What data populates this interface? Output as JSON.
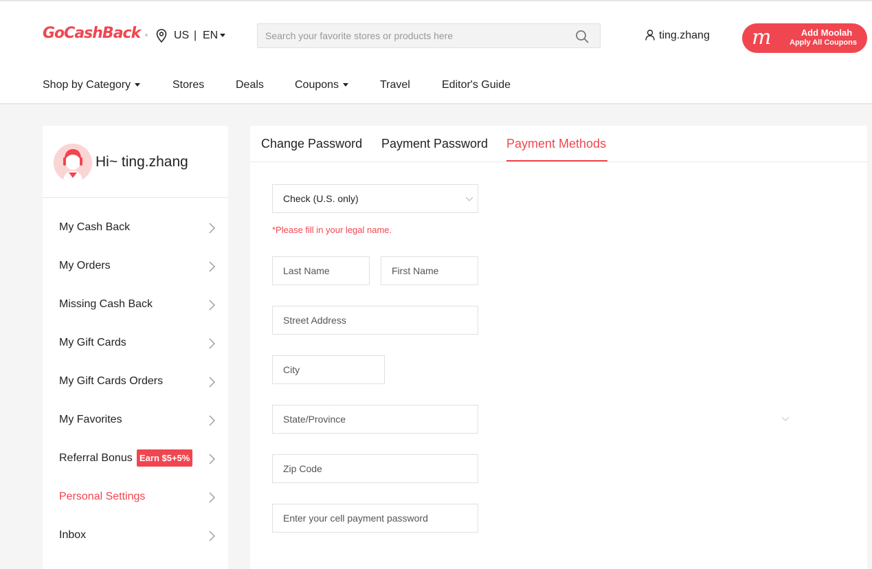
{
  "header": {
    "logo": "GoCashBack",
    "region": "US",
    "separator": "|",
    "language": "EN",
    "search_placeholder": "Search your favorite stores or products here",
    "username": "ting.zhang",
    "moolah_title": "Add Moolah",
    "moolah_subtitle": "Apply All Coupons",
    "moolah_icon_letter": "m"
  },
  "nav": {
    "items": [
      "Shop by Category",
      "Stores",
      "Deals",
      "Coupons",
      "Travel",
      "Editor's Guide"
    ]
  },
  "sidebar": {
    "greeting": "Hi~ ting.zhang",
    "items": [
      {
        "label": "My Cash Back"
      },
      {
        "label": "My Orders"
      },
      {
        "label": "Missing Cash Back"
      },
      {
        "label": "My Gift Cards"
      },
      {
        "label": "My Gift Cards Orders"
      },
      {
        "label": "My Favorites"
      },
      {
        "label": "Referral Bonus",
        "badge": "Earn $5+5%"
      },
      {
        "label": "Personal Settings",
        "active": true
      },
      {
        "label": "Inbox"
      }
    ]
  },
  "tabs": [
    {
      "label": "Change Password"
    },
    {
      "label": "Payment Password"
    },
    {
      "label": "Payment Methods",
      "active": true
    }
  ],
  "form": {
    "method_selected": "Check (U.S. only)",
    "notice": "*Please fill in your legal name.",
    "last_name_placeholder": "Last Name",
    "first_name_placeholder": "First Name",
    "street_placeholder": "Street Address",
    "city_placeholder": "City",
    "state_placeholder": "State/Province",
    "zip_placeholder": "Zip Code",
    "password_placeholder": "Enter your cell payment password"
  },
  "colors": {
    "accent": "#f04650"
  }
}
